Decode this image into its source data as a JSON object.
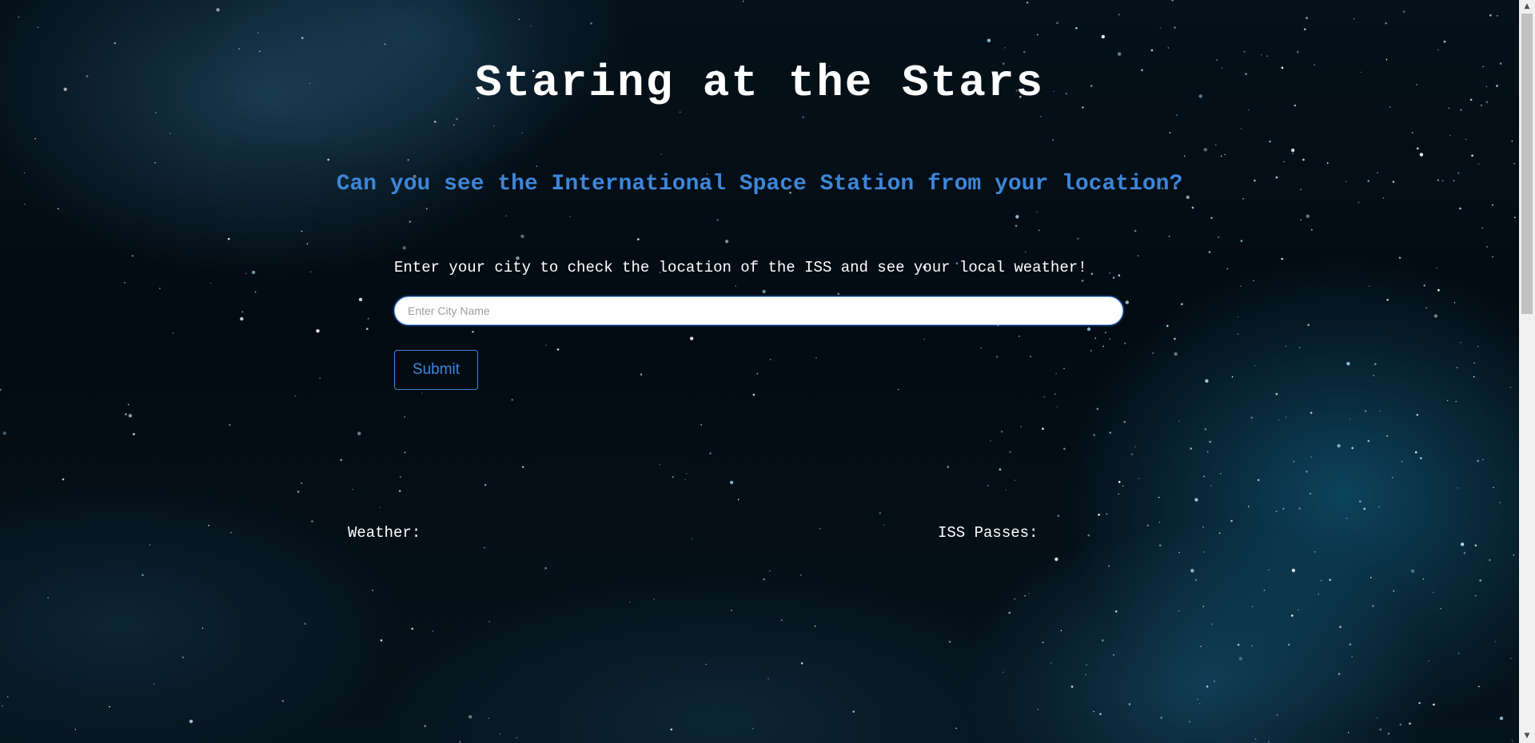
{
  "page": {
    "title": "Staring at the Stars",
    "subtitle": "Can you see the International Space Station from your location?"
  },
  "search": {
    "prompt": "Enter your city to check the location of the ISS and see your local weather!",
    "placeholder": "Enter City Name",
    "value": "",
    "submit_label": "Submit"
  },
  "results": {
    "weather_label": "Weather:",
    "iss_label": "ISS Passes:"
  },
  "scrollbar": {
    "up_icon": "▲",
    "down_icon": "▼"
  },
  "colors": {
    "accent": "#3d86d8",
    "text": "#ffffff",
    "background": "#030b12"
  }
}
